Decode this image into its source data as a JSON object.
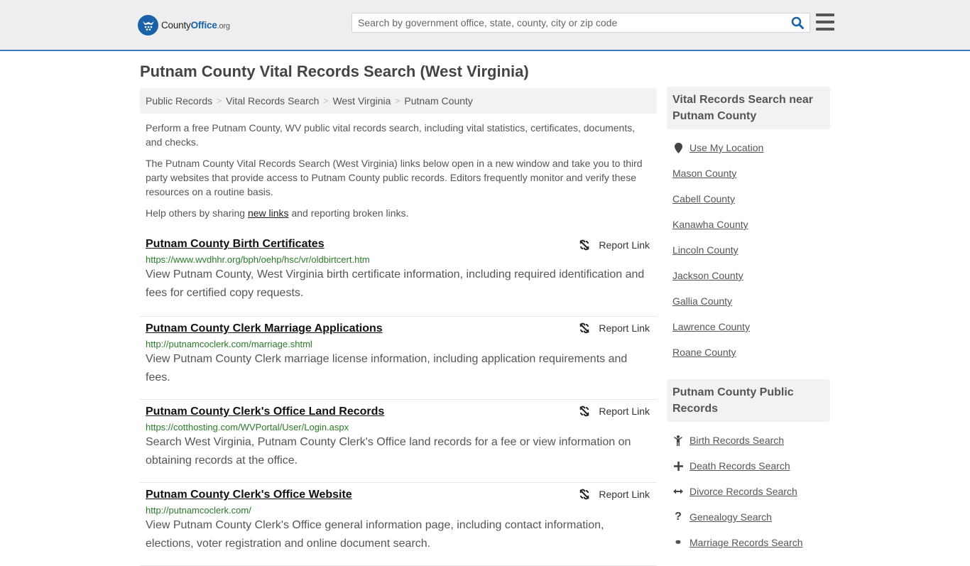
{
  "header": {
    "logo": {
      "name": "County",
      "brand": "Office",
      "tld": ".org"
    },
    "search_placeholder": "Search by government office, state, county, city or zip code",
    "search_value": ""
  },
  "page": {
    "title": "Putnam County Vital Records Search (West Virginia)"
  },
  "breadcrumb": [
    {
      "label": "Public Records"
    },
    {
      "label": "Vital Records Search"
    },
    {
      "label": "West Virginia"
    },
    {
      "label": "Putnam County"
    }
  ],
  "intro": {
    "p1": "Perform a free Putnam County, WV public vital records search, including vital statistics, certificates, documents, and checks.",
    "p2": "The Putnam County Vital Records Search (West Virginia) links below open in a new window and take you to third party websites that provide access to Putnam County public records. Editors frequently monitor and verify these resources on a routine basis.",
    "p3_before": "Help others by sharing ",
    "p3_link": "new links",
    "p3_after": " and reporting broken links."
  },
  "report_label": "Report Link",
  "results": [
    {
      "title": "Putnam County Birth Certificates",
      "url": "https://www.wvdhhr.org/bph/oehp/hsc/vr/oldbirtcert.htm",
      "description": "View Putnam County, West Virginia birth certificate information, including required identification and fees for certified copy requests."
    },
    {
      "title": "Putnam County Clerk Marriage Applications",
      "url": "http://putnamcoclerk.com/marriage.shtml",
      "description": "View Putnam County Clerk marriage license information, including application requirements and fees."
    },
    {
      "title": "Putnam County Clerk's Office Land Records",
      "url": "https://cotthosting.com/WVPortal/User/Login.aspx",
      "description": "Search West Virginia, Putnam County Clerk's Office land records for a fee or view information on obtaining records at the office."
    },
    {
      "title": "Putnam County Clerk's Office Website",
      "url": "http://putnamcoclerk.com/",
      "description": "View Putnam County Clerk's Office general information page, including contact information, elections, voter registration and online document search."
    }
  ],
  "sidebar": {
    "nearby": {
      "heading": "Vital Records Search near Putnam County",
      "use_location": "Use My Location",
      "items": [
        "Mason County",
        "Cabell County",
        "Kanawha County",
        "Lincoln County",
        "Jackson County",
        "Gallia County",
        "Lawrence County",
        "Roane County"
      ]
    },
    "public_records": {
      "heading": "Putnam County Public Records",
      "items": [
        {
          "label": "Birth Records Search",
          "icon": "child-icon"
        },
        {
          "label": "Death Records Search",
          "icon": "plus-icon"
        },
        {
          "label": "Divorce Records Search",
          "icon": "arrows-horizontal-icon"
        },
        {
          "label": "Genealogy Search",
          "icon": "question-icon"
        },
        {
          "label": "Marriage Records Search",
          "icon": "gender-icon"
        }
      ]
    }
  }
}
